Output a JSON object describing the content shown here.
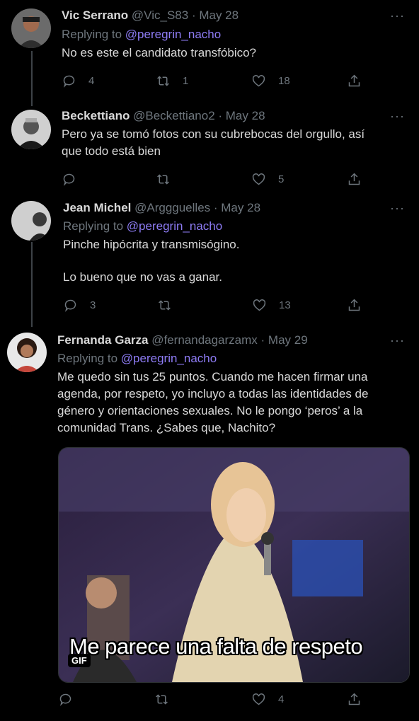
{
  "tweets": [
    {
      "name": "Vic Serrano",
      "handle": "@Vic_S83",
      "date": "· May 28",
      "replying_label": "Replying to",
      "replying_to": "@peregrin_nacho",
      "text_lines": [
        "No es este el candidato transfóbico?"
      ],
      "replies": "4",
      "retweets": "1",
      "likes": "18"
    },
    {
      "name": "Beckettiano",
      "handle": "@Beckettiano2",
      "date": "· May 28",
      "text_lines": [
        "Pero ya se tomó fotos con su cubrebocas del orgullo, así",
        "que todo está bien"
      ],
      "replies": "",
      "retweets": "",
      "likes": "5"
    },
    {
      "name": "Jean Michel",
      "handle": "@Arggguelles",
      "date": "· May 28",
      "replying_label": "Replying to",
      "replying_to": "@peregrin_nacho",
      "text_lines": [
        "Pinche hipócrita y transmisógino.",
        "",
        "Lo bueno que no vas a ganar."
      ],
      "replies": "3",
      "retweets": "",
      "likes": "13"
    },
    {
      "name": "Fernanda Garza",
      "handle": "@fernandagarzamx",
      "date": "· May 29",
      "replying_label": "Replying to",
      "replying_to": "@peregrin_nacho",
      "text_lines": [
        "Me quedo sin tus 25 puntos. Cuando me hacen firmar una",
        "agenda, por respeto, yo incluyo a todas las identidades de",
        "género y orientaciones sexuales. No le pongo ‘peros’ a la",
        "comunidad Trans. ¿Sabes que, Nachito?"
      ],
      "gif_caption": "Me parece una falta de respeto",
      "gif_badge": "GIF",
      "replies": "",
      "retweets": "",
      "likes": "4"
    }
  ],
  "more_glyph": "···",
  "icons": [
    "reply-icon",
    "retweet-icon",
    "like-icon",
    "share-icon",
    "more-icon"
  ],
  "colors": {
    "background": "#000000",
    "text": "#d9d9d9",
    "muted": "#6e767d",
    "mention": "#8e7cf5",
    "thread_line": "#3d4247"
  }
}
